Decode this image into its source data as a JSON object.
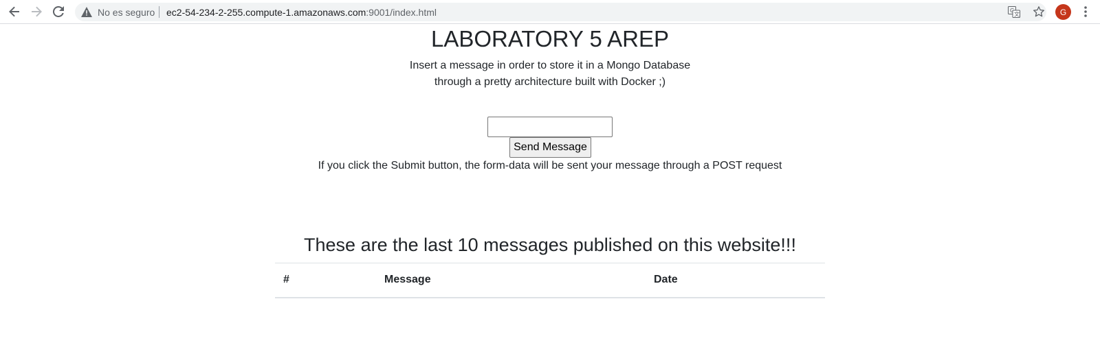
{
  "browser": {
    "security_label": "No es seguro",
    "url_host": "ec2-54-234-2-255.compute-1.amazonaws.com",
    "url_rest": ":9001/index.html",
    "avatar_initial": "G"
  },
  "page": {
    "title": "LABORATORY 5 AREP",
    "intro_line1": "Insert a message in order to store it in a Mongo Database",
    "intro_line2": "through a pretty architecture built with Docker ;)",
    "input_value": "",
    "send_button_label": "Send Message",
    "note": "If you click the Submit button, the form-data will be sent your message through a POST request",
    "messages_title": "These are the last 10 messages published on this website!!!",
    "table_headers": [
      "#",
      "Message",
      "Date"
    ],
    "table_rows": []
  }
}
